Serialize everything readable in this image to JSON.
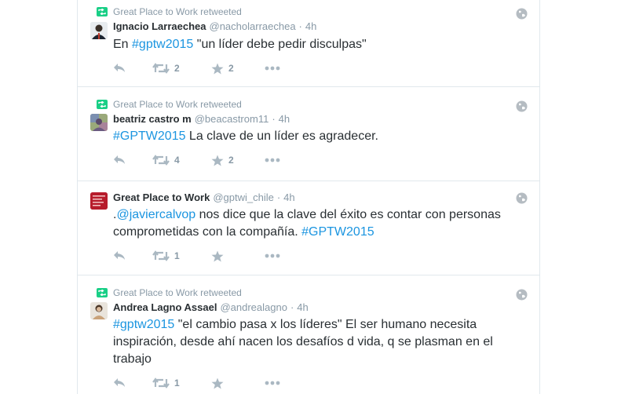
{
  "tweets": [
    {
      "retweeted_by": "Great Place to Work retweeted",
      "fullname": "Ignacio Larraechea",
      "username": "@nacholarraechea",
      "time": "4h",
      "text_parts": [
        "En ",
        "#gptw2015",
        " \"un líder debe pedir disculpas\""
      ],
      "retweets": "2",
      "likes": "2"
    },
    {
      "retweeted_by": "Great Place to Work retweeted",
      "fullname": "beatriz castro m",
      "username": "@beacastrom11",
      "time": "4h",
      "text_parts": [
        "#GPTW2015",
        " La clave de un líder es agradecer."
      ],
      "retweets": "4",
      "likes": "2"
    },
    {
      "fullname": "Great Place to Work",
      "username": "@gptwi_chile",
      "time": "4h",
      "text_line1": [
        ".",
        "@javiercalvop",
        " nos dice que la clave del éxito es contar con personas"
      ],
      "text_line2": [
        "comprometidas con la compañía. ",
        "#GPTW2015"
      ],
      "retweets": "1",
      "likes": ""
    },
    {
      "retweeted_by": "Great Place to Work retweeted",
      "fullname": "Andrea Lagno Assael",
      "username": "@andrealagno",
      "time": "4h",
      "text_line1": [
        "#gptw2015",
        " \"el cambio pasa x los líderes\" El ser humano necesita"
      ],
      "text_line2": "inspiración, desde ahí nacen los desafíos d vida, q se plasman en el",
      "text_line3": "trabajo",
      "retweets": "1",
      "likes": ""
    }
  ],
  "separator": "·",
  "colors": {
    "link": "#1b95e0",
    "muted": "#8899a6",
    "retweet_green": "#19cf86",
    "border": "#e1e8ed"
  },
  "icons": [
    "retweet-badge-icon",
    "reply-icon",
    "retweet-icon",
    "like-icon",
    "more-icon",
    "globe-icon"
  ]
}
